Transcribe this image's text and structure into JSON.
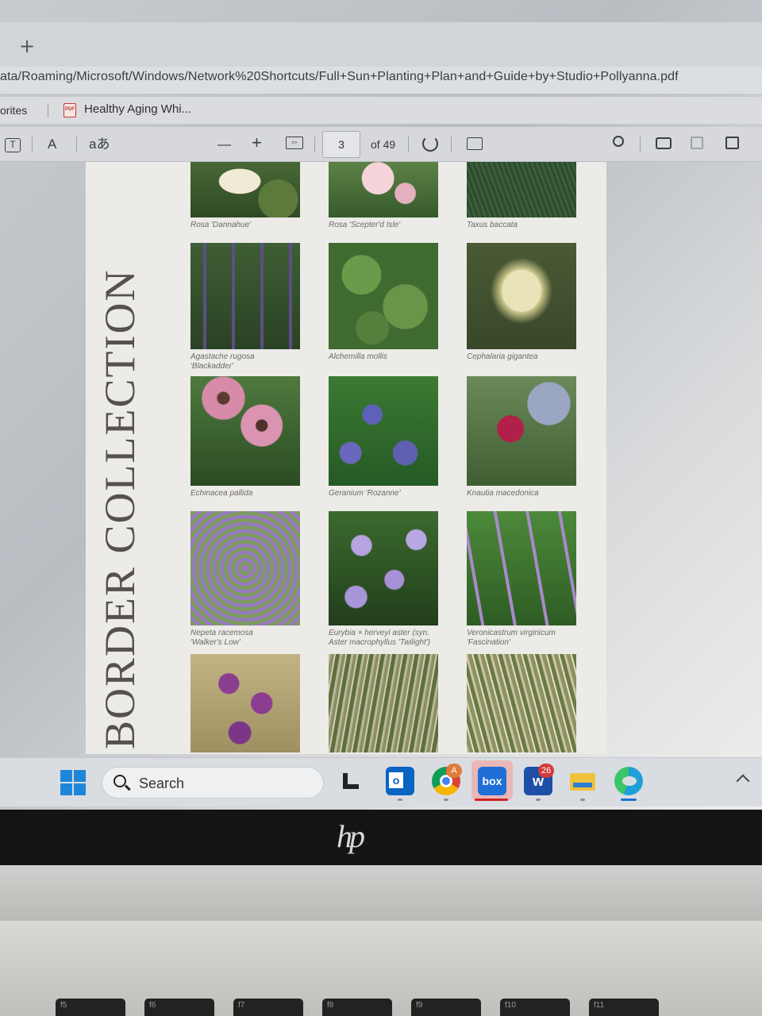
{
  "browser": {
    "new_tab_symbol": "+",
    "address": "ata/Roaming/Microsoft/Windows/Network%20Shortcuts/Full+Sun+Planting+Plan+and+Guide+by+Studio+Pollyanna.pdf",
    "favorites_label": "orites",
    "favorite_item": "Healthy Aging Whi..."
  },
  "pdf_toolbar": {
    "text_tool": "T",
    "read_aloud": "A",
    "translate": "aあ",
    "zoom_out": "—",
    "zoom_in": "+",
    "fit": "⇔",
    "page_current": "3",
    "page_total": "of 49"
  },
  "pdf_page": {
    "vertical_title": "BORDER COLLECTION",
    "plants": [
      {
        "caption": "Rosa 'Dannahue'",
        "image": "img-rose1"
      },
      {
        "caption": "Rosa 'Scepter'd Isle'",
        "image": "img-rose2"
      },
      {
        "caption": "Taxus baccata",
        "image": "img-taxus"
      },
      {
        "caption": "Agastache rugosa",
        "caption2": "'Blackadder'",
        "image": "img-agastache"
      },
      {
        "caption": "Alchemilla mollis",
        "image": "img-alchemilla"
      },
      {
        "caption": "Cephalaria gigantea",
        "image": "img-cephalaria"
      },
      {
        "caption": "Echinacea pallida",
        "image": "img-echinacea"
      },
      {
        "caption": "Geranium 'Rozanne'",
        "image": "img-geranium"
      },
      {
        "caption": "Knautia macedonica",
        "image": "img-knautia"
      },
      {
        "caption": "Nepeta racemosa",
        "caption2": "'Walker's Low'",
        "image": "img-nepeta"
      },
      {
        "caption": "Eurybia × herveyi aster (syn.",
        "caption2": "Aster macrophyllus 'Twilight')",
        "image": "img-eurybia"
      },
      {
        "caption": "Veronicastrum virginicum",
        "caption2": "'Fascination'",
        "image": "img-veronicastrum"
      },
      {
        "caption": "",
        "image": "img-verbena"
      },
      {
        "caption": "",
        "image": "img-grass1"
      },
      {
        "caption": "",
        "image": "img-grass2"
      }
    ]
  },
  "taskbar": {
    "search_label": "Search",
    "outlook_letter": "o",
    "chrome_badge": "A",
    "box_label": "box",
    "webex_badge": "26",
    "colors": {
      "windows": "#1e86d9",
      "outlook": "#0a64c2",
      "box": "#1f6fd6",
      "webex": "#1d4ea8",
      "explorer": "#f2c13c",
      "edge": "#1fa0d8"
    }
  },
  "laptop": {
    "brand": "hp",
    "keys": [
      "f5",
      "f6",
      "f7",
      "f8",
      "f9",
      "f10",
      "f11"
    ]
  }
}
